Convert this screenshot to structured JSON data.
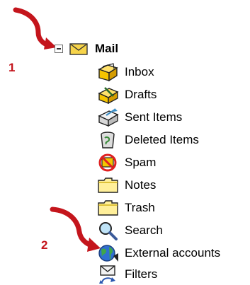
{
  "annotations": {
    "step1": "1",
    "step2": "2",
    "accent_color": "#c4151c"
  },
  "tree": {
    "root": {
      "label": "Mail",
      "icon": "mail-envelope-icon",
      "expanded": true
    },
    "items": [
      {
        "label": "Inbox",
        "icon": "inbox-icon"
      },
      {
        "label": "Drafts",
        "icon": "drafts-icon"
      },
      {
        "label": "Sent Items",
        "icon": "sent-items-icon"
      },
      {
        "label": "Deleted Items",
        "icon": "trash-can-icon"
      },
      {
        "label": "Spam",
        "icon": "spam-icon"
      },
      {
        "label": "Notes",
        "icon": "folder-icon"
      },
      {
        "label": "Trash",
        "icon": "folder-icon"
      },
      {
        "label": "Search",
        "icon": "magnifier-icon"
      },
      {
        "label": "External accounts",
        "icon": "globe-icon"
      },
      {
        "label": "Filters",
        "icon": "filter-envelope-icon"
      }
    ]
  }
}
